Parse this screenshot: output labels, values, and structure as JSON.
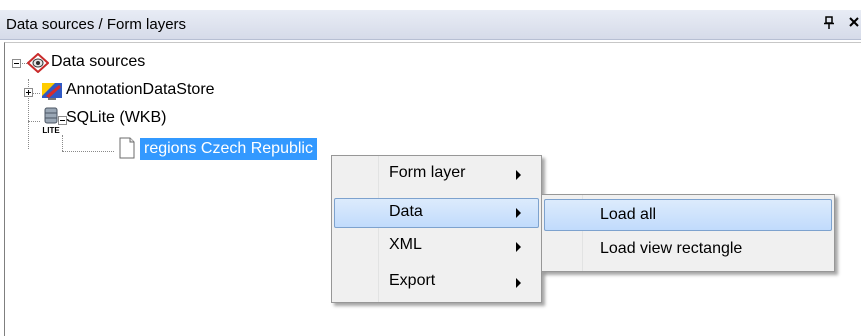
{
  "panel": {
    "title": "Data sources / Form layers",
    "pin_glyph": "ᵖ",
    "close_glyph": "×"
  },
  "tree": {
    "root_label": "Data sources",
    "children": [
      {
        "label": "AnnotationDataStore",
        "icon": "annotation-datastore-icon",
        "expanded": false
      },
      {
        "label": "SQLite (WKB)",
        "icon": "sqlite-icon",
        "expanded": true,
        "icon_caption": "LITE"
      }
    ],
    "layer": {
      "label": "regions Czech Republic",
      "icon": "document-icon",
      "selected": true
    }
  },
  "context_menu": {
    "items": [
      {
        "label": "Form layer",
        "has_submenu": true
      },
      {
        "label": "Data",
        "has_submenu": true,
        "highlighted": true
      },
      {
        "label": "XML",
        "has_submenu": true
      },
      {
        "label": "Export",
        "has_submenu": true
      }
    ]
  },
  "submenu": {
    "items": [
      {
        "label": "Load all",
        "highlighted": true
      },
      {
        "label": "Load view rectangle"
      }
    ]
  },
  "colors": {
    "selection": "#3399ff",
    "menu_bg": "#f0f0f0",
    "menu_highlight_border": "#7da2ce"
  }
}
